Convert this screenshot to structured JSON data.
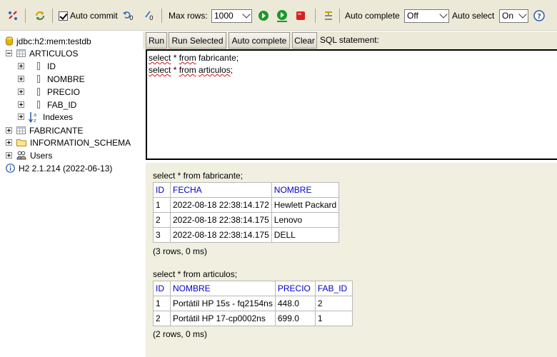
{
  "toolbar": {
    "auto_commit_label": "Auto commit",
    "auto_commit_checked": true,
    "max_rows_label": "Max rows:",
    "max_rows_value": "1000",
    "auto_complete_label": "Auto complete",
    "auto_complete_value": "Off",
    "auto_select_label": "Auto select",
    "auto_select_value": "On",
    "help_glyph": "?"
  },
  "tree": {
    "connection": "jdbc:h2:mem:testdb",
    "table1": "ARTICULOS",
    "columns": [
      "ID",
      "NOMBRE",
      "PRECIO",
      "FAB_ID"
    ],
    "indexes": "Indexes",
    "table2": "FABRICANTE",
    "schema": "INFORMATION_SCHEMA",
    "users": "Users",
    "version": "H2 2.1.214 (2022-06-13)"
  },
  "buttons": {
    "run": "Run",
    "run_selected": "Run Selected",
    "auto_complete": "Auto complete",
    "clear": "Clear",
    "sql_statement": "SQL statement:"
  },
  "editor": {
    "line1": {
      "kw": "select",
      "mid": " * ",
      "from": "from",
      "tail": " fabricante;"
    },
    "line2": {
      "kw": "select",
      "mid": " * ",
      "from": "from",
      "tail": " ",
      "table": "articulos",
      "end": ";"
    }
  },
  "result1": {
    "query": "select * from fabricante;",
    "headers": [
      "ID",
      "FECHA",
      "NOMBRE"
    ],
    "rows": [
      [
        "1",
        "2022-08-18 22:38:14.172",
        "Hewlett Packard"
      ],
      [
        "2",
        "2022-08-18 22:38:14.175",
        "Lenovo"
      ],
      [
        "3",
        "2022-08-18 22:38:14.175",
        "DELL"
      ]
    ],
    "footer": "(3 rows, 0 ms)"
  },
  "result2": {
    "query": "select * from articulos;",
    "headers": [
      "ID",
      "NOMBRE",
      "PRECIO",
      "FAB_ID"
    ],
    "rows": [
      [
        "1",
        "Portátil HP 15s - fq2154ns",
        "448.0",
        "2"
      ],
      [
        "2",
        "Portátil HP 17-cp0002ns",
        "699.0",
        "1"
      ]
    ],
    "footer": "(2 rows, 0 ms)"
  },
  "colors": {
    "toolbar_bg": "#ece9d8",
    "results_bg": "#f0efe0",
    "header_link": "#0000cc",
    "run_green": "#1a9a2a",
    "stop_red": "#d92020"
  }
}
